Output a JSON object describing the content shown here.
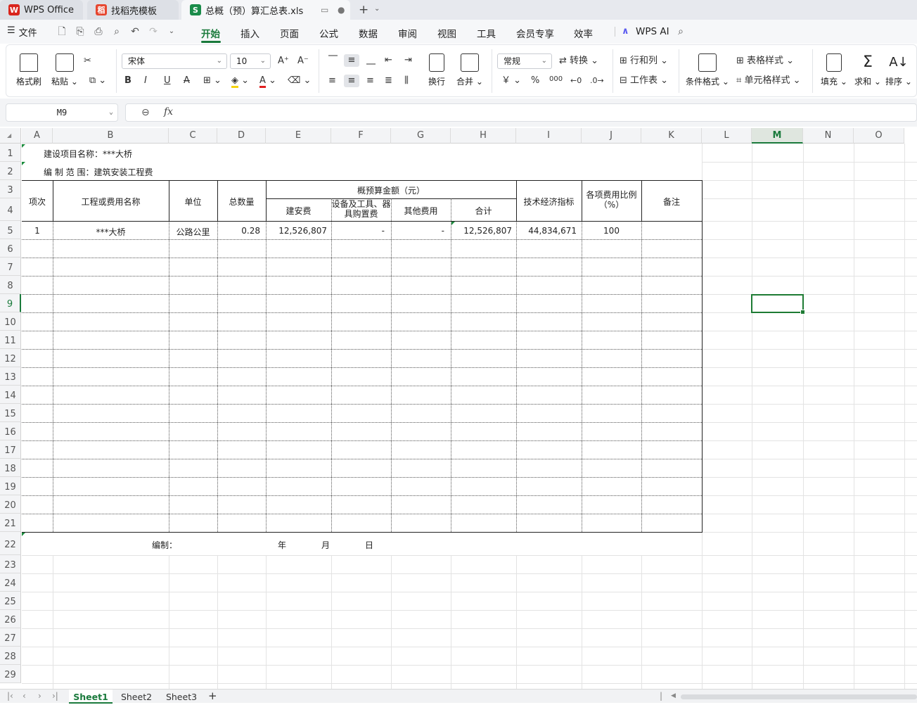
{
  "tabs": [
    {
      "label": "WPS Office",
      "icon": "wps-logo-icon"
    },
    {
      "label": "找稻壳模板",
      "icon": "docer-icon"
    },
    {
      "label": "总概（预）算汇总表.xls",
      "icon": "spreadsheet-icon"
    }
  ],
  "menu": {
    "file": "文件",
    "tabs": [
      "开始",
      "插入",
      "页面",
      "公式",
      "数据",
      "审阅",
      "视图",
      "工具",
      "会员专享",
      "效率"
    ],
    "selected_tab": "开始",
    "wps_ai": "WPS AI"
  },
  "ribbon": {
    "format_painter": "格式刷",
    "paste": "粘贴",
    "font_name": "宋体",
    "font_size": "10",
    "wrap": "换行",
    "merge": "合并",
    "number_format": "常规",
    "convert": "转换",
    "rows_cols": "行和列",
    "worksheet": "工作表",
    "cond_format": "条件格式",
    "table_style": "表格样式",
    "cell_style": "单元格样式",
    "fill": "填充",
    "sum": "求和",
    "sort": "排序",
    "currency": "￥",
    "percent": "%",
    "thousands": "000"
  },
  "namebox": "M9",
  "fx": "fx",
  "columns": [
    "A",
    "B",
    "C",
    "D",
    "E",
    "F",
    "G",
    "H",
    "I",
    "J",
    "K",
    "L",
    "M",
    "N",
    "O"
  ],
  "selected_column": "M",
  "rows": [
    "1",
    "2",
    "3",
    "4",
    "5",
    "6",
    "7",
    "8",
    "9",
    "10",
    "11",
    "12",
    "13",
    "14",
    "15",
    "16",
    "17",
    "18",
    "19",
    "20",
    "21",
    "22",
    "23",
    "24",
    "25",
    "26",
    "27",
    "28",
    "29"
  ],
  "selected_row": "9",
  "sheet": {
    "title_line": "建设项目名称：***大桥",
    "scope_line": "编 制 范 围：建筑安装工程费",
    "headers": {
      "seq": "项次",
      "name": "工程或费用名称",
      "unit": "单位",
      "qty": "总数量",
      "amount_group": "概预算金额（元）",
      "jianan": "建安费",
      "equip": "设备及工具、器具购置费",
      "other": "其他费用",
      "total": "合计",
      "tech": "技术经济指标",
      "ratio": "各项费用比例（%）",
      "note": "备注"
    },
    "row5": {
      "seq": "1",
      "name": "***大桥",
      "unit": "公路公里",
      "qty": "0.28",
      "jianan": "12,526,807",
      "equip": "-",
      "other": "-",
      "total": "12,526,807",
      "tech": "44,834,671",
      "ratio": "100"
    },
    "footer": {
      "compiled": "编制：",
      "year": "年",
      "month": "月",
      "day": "日"
    }
  },
  "sheet_tabs": [
    "Sheet1",
    "Sheet2",
    "Sheet3"
  ],
  "active_sheet": "Sheet1"
}
